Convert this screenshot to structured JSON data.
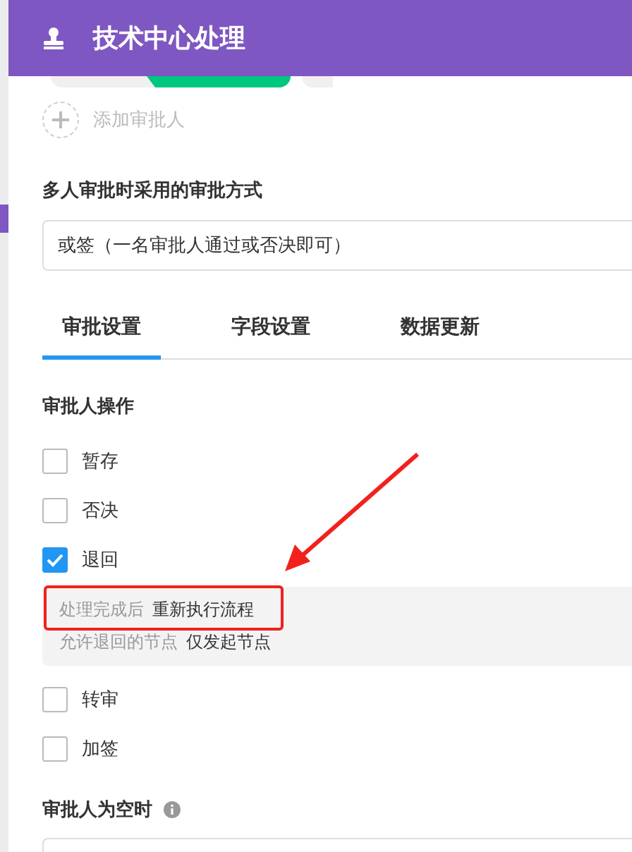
{
  "header": {
    "title": "技术中心处理"
  },
  "add_approver": {
    "label": "添加审批人"
  },
  "approval_mode": {
    "label": "多人审批时采用的审批方式",
    "value": "或签（一名审批人通过或否决即可）"
  },
  "tabs": [
    {
      "label": "审批设置",
      "selected": true
    },
    {
      "label": "字段设置",
      "selected": false
    },
    {
      "label": "数据更新",
      "selected": false
    }
  ],
  "operations": {
    "label": "审批人操作",
    "items": [
      {
        "label": "暂存",
        "checked": false
      },
      {
        "label": "否决",
        "checked": false
      },
      {
        "label": "退回",
        "checked": true,
        "details": [
          {
            "name": "处理完成后",
            "value": "重新执行流程",
            "highlighted": true
          },
          {
            "name": "允许退回的节点",
            "value": "仅发起节点",
            "highlighted": false
          }
        ]
      },
      {
        "label": "转审",
        "checked": false
      },
      {
        "label": "加签",
        "checked": false
      }
    ]
  },
  "empty_approver": {
    "label": "审批人为空时"
  }
}
